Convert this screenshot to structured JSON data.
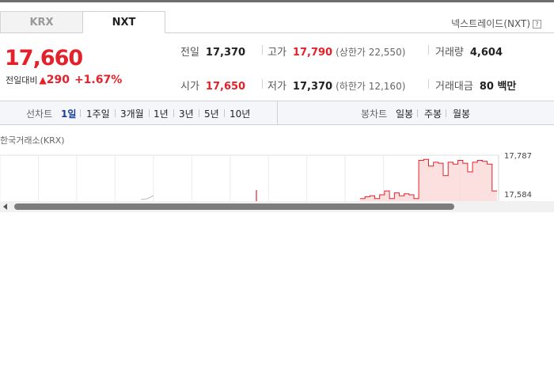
{
  "tabs": [
    {
      "label": "KRX",
      "active": false
    },
    {
      "label": "NXT",
      "active": true
    }
  ],
  "nxt_link": {
    "label": "넥스트레이드(NXT)",
    "help": "?"
  },
  "quote": {
    "price": "17,660",
    "change_label": "전일대비",
    "change_arrow": "▲",
    "change": "290",
    "change_pct": "+1.67%"
  },
  "stats": {
    "prev_close": {
      "label": "전일",
      "value": "17,370"
    },
    "open": {
      "label": "시가",
      "value": "17,650"
    },
    "high": {
      "label": "고가",
      "value": "17,790",
      "sub": "(상한가 22,550)"
    },
    "low": {
      "label": "저가",
      "value": "17,370",
      "sub": "(하한가 12,160)"
    },
    "volume": {
      "label": "거래량",
      "value": "4,604"
    },
    "turnover": {
      "label": "거래대금",
      "value": "80 백만"
    }
  },
  "periods": {
    "line_label": "선차트",
    "line_items": [
      "1일",
      "1주일",
      "3개월",
      "1년",
      "3년",
      "5년",
      "10년"
    ],
    "candle_label": "봉차트",
    "candle_items": [
      "일봉",
      "주봉",
      "월봉"
    ],
    "active": "1일"
  },
  "chart_title": "한국거래소(KRX)",
  "colors": {
    "up": "#e4202a",
    "area": "#fbd8d8",
    "active": "#1a3e9c"
  },
  "chart_data": {
    "type": "line",
    "y_ticks": [
      "17,787",
      "17,584"
    ],
    "series": [
      {
        "values": [
          17560,
          17570,
          17575,
          17560,
          17580,
          17600,
          17560,
          17590,
          17575,
          17585,
          17580,
          17560,
          17760,
          17765,
          17730,
          17750,
          17745,
          17680,
          17750,
          17740,
          17760,
          17745,
          17700,
          17750,
          17760,
          17755,
          17740,
          17600,
          17600
        ]
      }
    ]
  }
}
